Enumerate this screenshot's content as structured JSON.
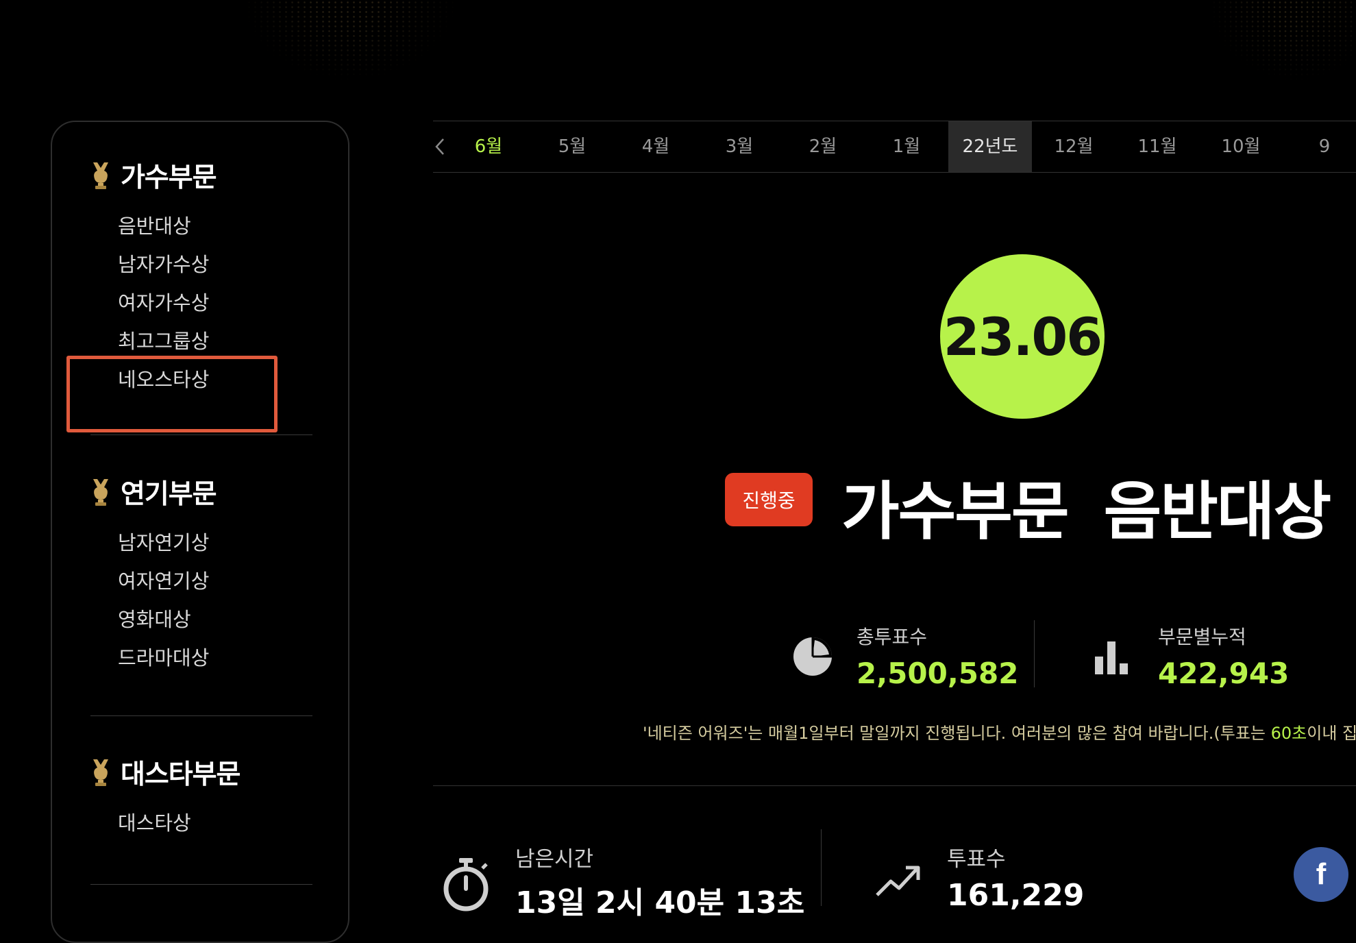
{
  "sidebar": {
    "sections": [
      {
        "title": "가수부문",
        "items": [
          "음반대상",
          "남자가수상",
          "여자가수상",
          "최고그룹상",
          "네오스타상"
        ]
      },
      {
        "title": "연기부문",
        "items": [
          "남자연기상",
          "여자연기상",
          "영화대상",
          "드라마대상"
        ]
      },
      {
        "title": "대스타부문",
        "items": [
          "대스타상"
        ]
      }
    ]
  },
  "tabs": {
    "prev_icon": "chevron-left-icon",
    "items": [
      "6월",
      "5월",
      "4월",
      "3월",
      "2월",
      "1월",
      "22년도",
      "12월",
      "11월",
      "10월",
      "9"
    ],
    "active_index": 0,
    "selected_index": 6
  },
  "award": {
    "period": "23.06",
    "status": "진행중",
    "title": "가수부문  음반대상"
  },
  "stats": {
    "total_label": "총투표수",
    "total_value": "2,500,582",
    "section_label": "부문별누적",
    "section_value": "422,943"
  },
  "notice": {
    "before": "'네티즌 어워즈'는 매월1일부터 말일까지 진행됩니다. 여러분의 많은 참여 바랍니다.(투표는 ",
    "highlight": "60초",
    "after": "이내 집계"
  },
  "bottom": {
    "time_label": "남은시간",
    "time_value": "13일 2시 40분 13초",
    "votes_label": "투표수",
    "votes_value": "161,229"
  },
  "social": {
    "facebook_glyph": "f"
  },
  "colors": {
    "accent": "#b7f24a",
    "status": "#e03b22",
    "highlight_box": "#e05a3c",
    "facebook": "#3b5aa0"
  }
}
